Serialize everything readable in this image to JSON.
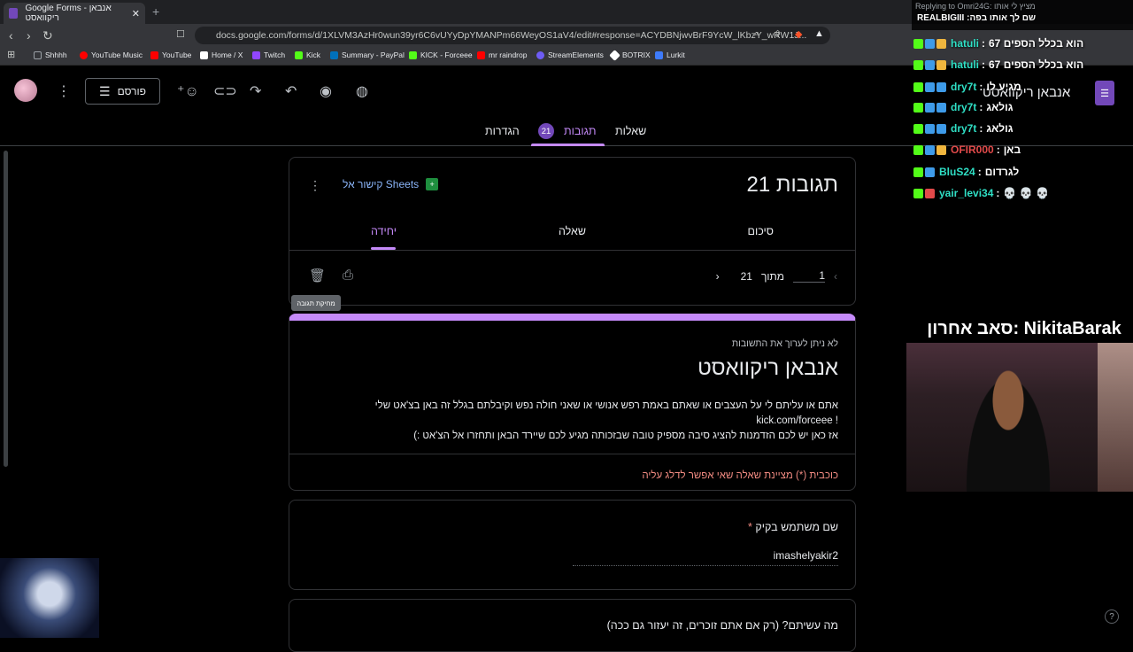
{
  "browser": {
    "tab_title": "Google Forms - אנבאן ריקוואסט",
    "new_tab_glyph": "+",
    "url": "docs.google.com/forms/d/1XLVM3AzHr0wun39yr6C6vUYyDpYMANPm66WeyOS1aV4/edit#response=ACYDBNjwvBrF9YcW_lKbzY_wRW1J...",
    "bookmarks": [
      {
        "label": "Shhhh",
        "icon": "folder-icon",
        "color": "#9aa0a6"
      },
      {
        "label": "YouTube Music",
        "icon": "youtube-music-icon",
        "color": "#ff0000"
      },
      {
        "label": "YouTube",
        "icon": "youtube-icon",
        "color": "#ff0000"
      },
      {
        "label": "Home / X",
        "icon": "x-icon",
        "color": "#ffffff"
      },
      {
        "label": "Twitch",
        "icon": "twitch-icon",
        "color": "#9146ff"
      },
      {
        "label": "Kick",
        "icon": "kick-icon",
        "color": "#53fc18"
      },
      {
        "label": "Summary - PayPal",
        "icon": "paypal-icon",
        "color": "#0070ba"
      },
      {
        "label": "KICK - Forceee",
        "icon": "kick-icon",
        "color": "#53fc18"
      },
      {
        "label": "mr raindrop",
        "icon": "youtube-icon",
        "color": "#ff0000"
      },
      {
        "label": "StreamElements",
        "icon": "streamelements-icon",
        "color": "#6e5cf5"
      },
      {
        "label": "BOTRIX",
        "icon": "botrix-icon",
        "color": "#ffffff"
      },
      {
        "label": "Lurkit",
        "icon": "lurkit-icon",
        "color": "#3e7bfa"
      }
    ]
  },
  "forms": {
    "forms_button": "פורסם",
    "top_title": "אנבאן ריקוואסט",
    "tabs": {
      "questions": "שאלות",
      "responses": "תגובות",
      "settings": "הגדרות",
      "responses_count": "21"
    },
    "summary": {
      "count_title": "21 תגובות",
      "sheets_link": "קישור אל Sheets",
      "subtabs": {
        "summary": "סיכום",
        "question": "שאלה",
        "individual": "יחידה"
      },
      "tooltip": "מחיקת תגובה",
      "pager_current": "1",
      "pager_of": "מתוך",
      "pager_total": "21"
    },
    "header": {
      "cannot_edit": "לא ניתן לערוך את התשובות",
      "title": "אנבאן ריקוואסט",
      "description_line1": "אתם או עליתם לי על העצבים או שאתם באמת רפש אנושי או שאני חולה נפש וקיבלתם בגלל זה באן בצ'אט שלי",
      "description_line2": "kick.com/forceee !",
      "description_line3": "אז כאן יש לכם הזדמנות להציג סיבה מספיק טובה שבזכותה מגיע לכם שיירד הבאן ותחזרו אל הצ'אט :)",
      "required_note": "כוכבית (*) מציינת שאלה שאי אפשר לדלג עליה"
    },
    "questions": [
      {
        "label": "שם משתמש בקיק",
        "required_mark": "*",
        "answer": "imashelyakir2"
      },
      {
        "label": "מה עשיתם? (רק אם אתם זוכרים, זה יעזור גם ככה)"
      }
    ]
  },
  "chat": {
    "replying_to": "Replying to Omri24G: מציץ לי אותו",
    "reply_line": "שם לך אותו בפה: REALBIGIII",
    "messages": [
      {
        "user": "hatuli",
        "color": "#2fdfc5",
        "text": "הוא בכלל הספים 67"
      },
      {
        "user": "hatuli",
        "color": "#2fdfc5",
        "text": "הוא בכלל הספים 67"
      },
      {
        "user": "dry7t",
        "color": "#2fdfc5",
        "text": "מגיע לו"
      },
      {
        "user": "dry7t",
        "color": "#2fdfc5",
        "text": "גולאג"
      },
      {
        "user": "dry7t",
        "color": "#2fdfc5",
        "text": "גולאג"
      },
      {
        "user": "OFIR000",
        "color": "#e24a4a",
        "text": "באן"
      },
      {
        "user": "BluS24",
        "color": "#2fdfc5",
        "text": "לגרדום"
      },
      {
        "user": "yair_levi34",
        "color": "#2fdfc5",
        "text": "💀 💀 💀"
      }
    ],
    "last_sub": "סאב אחרון: NikitaBarak"
  }
}
